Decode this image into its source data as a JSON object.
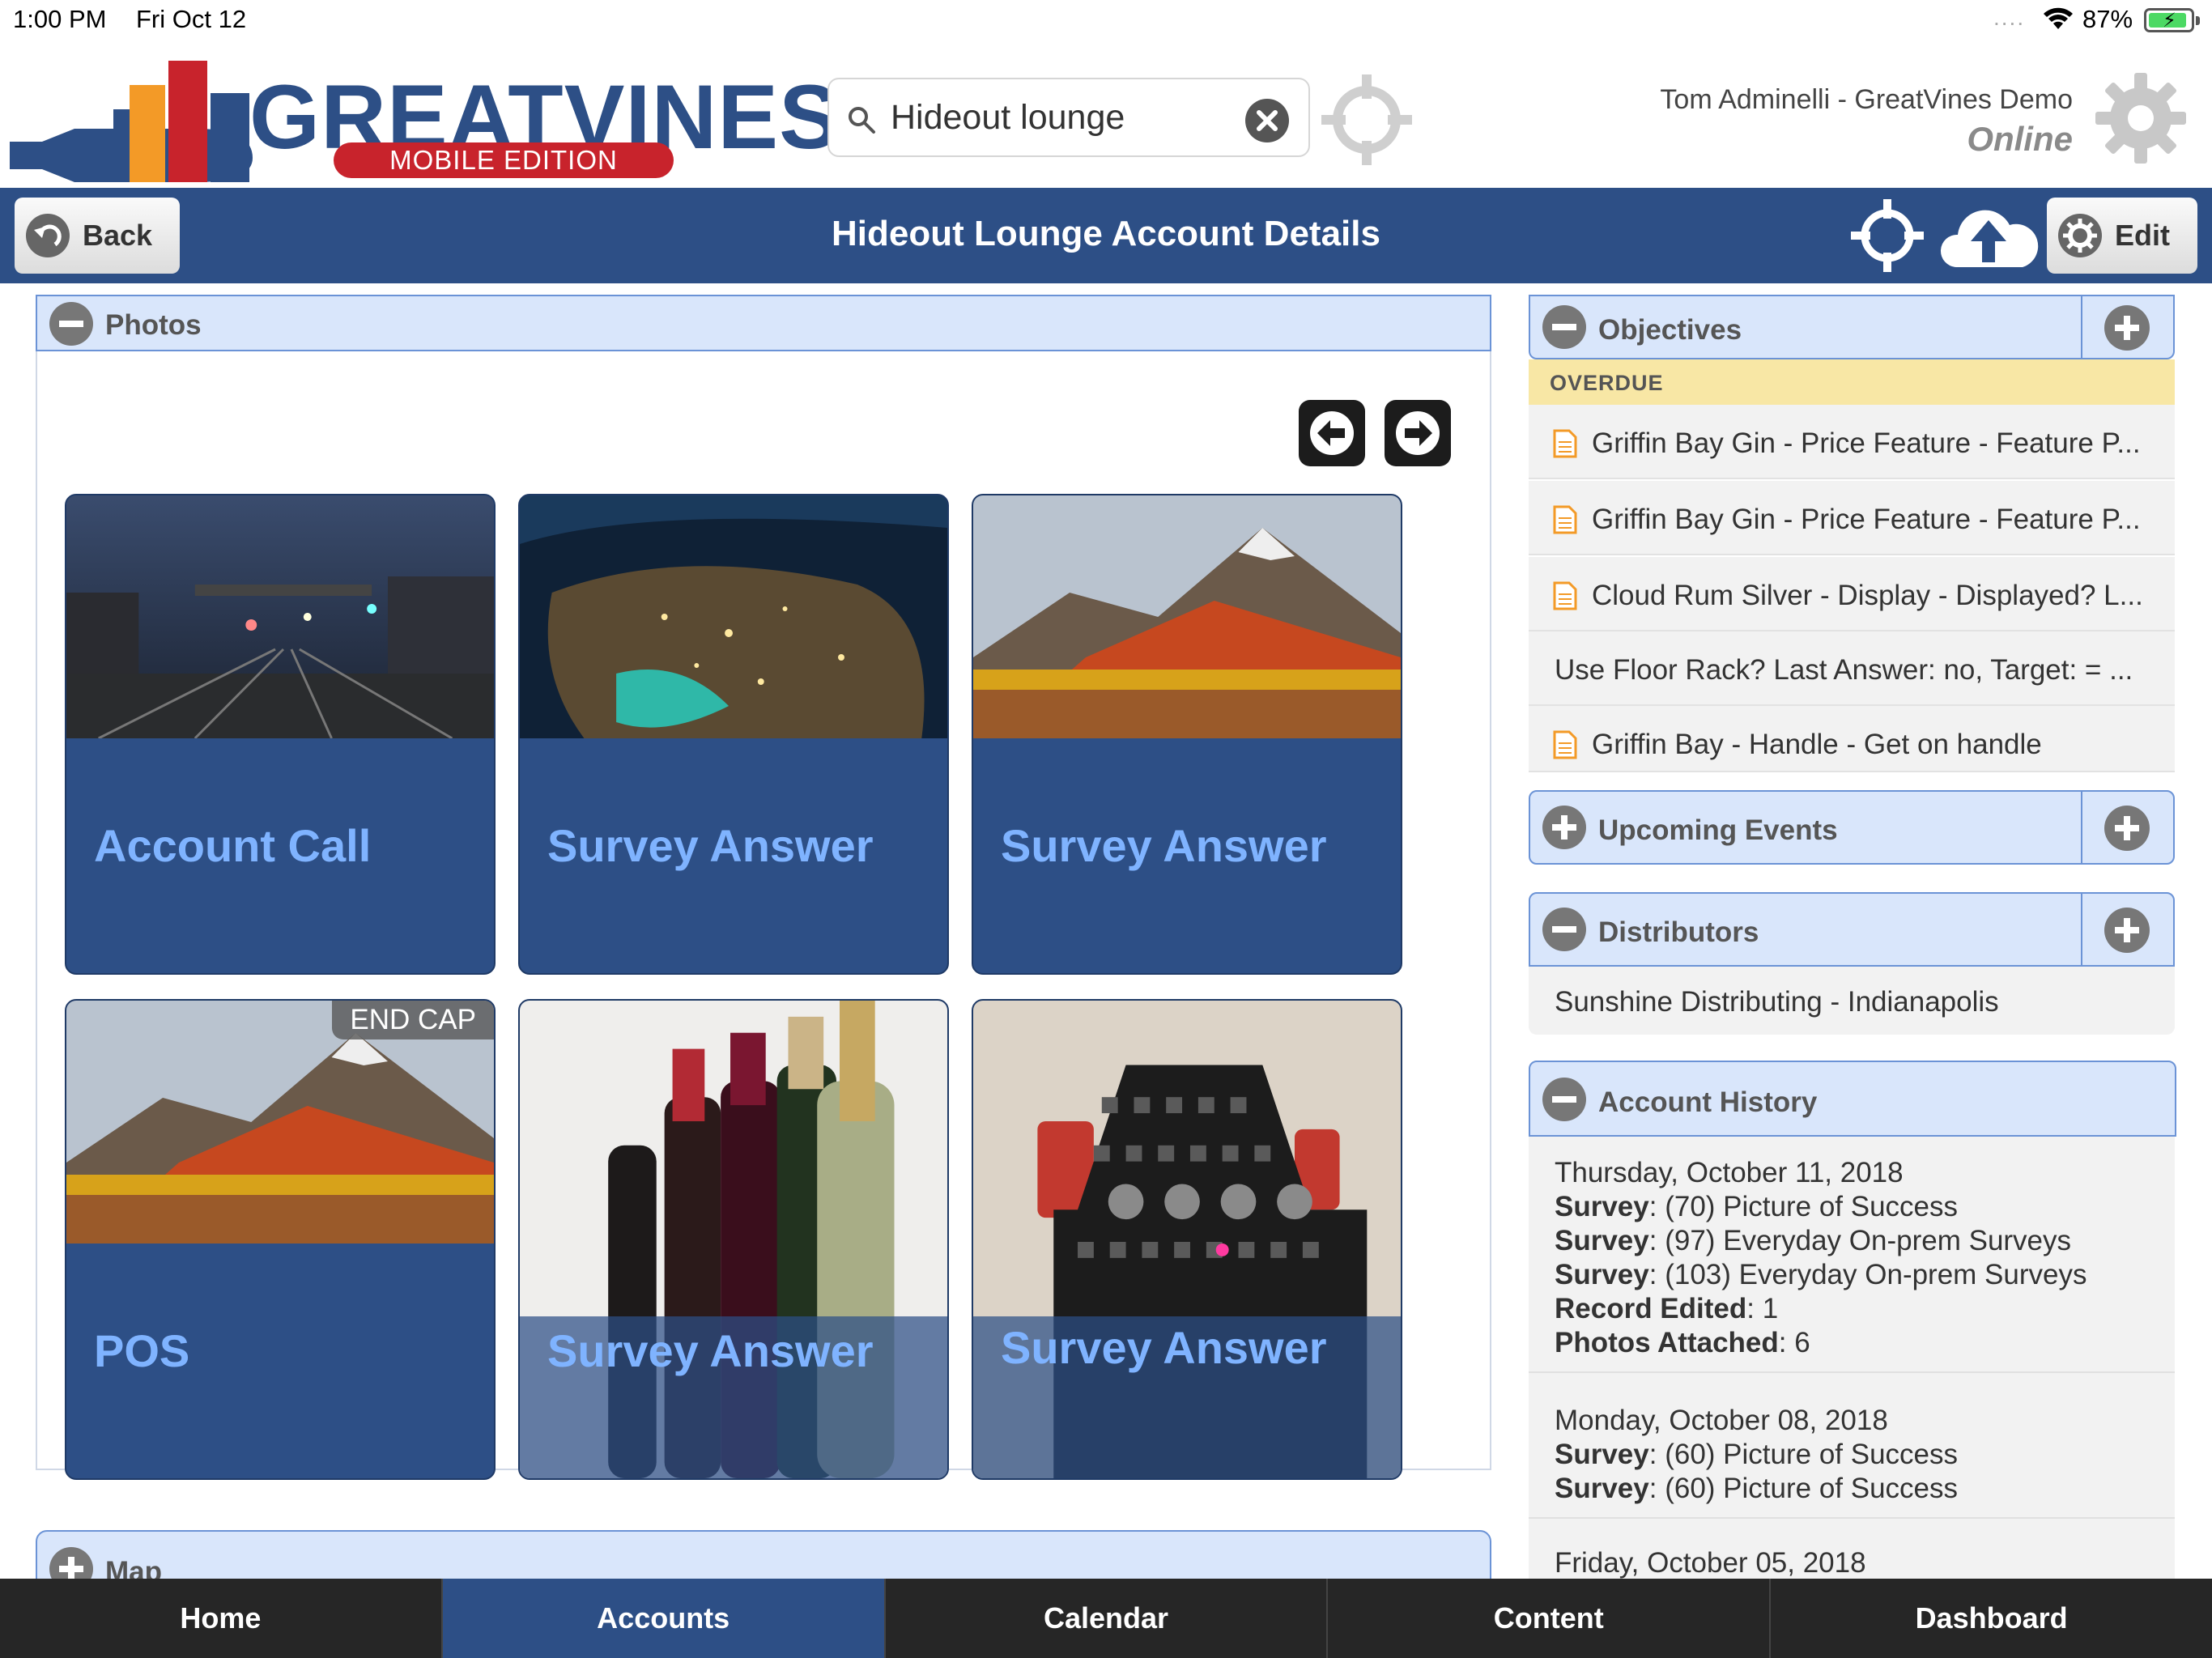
{
  "status_bar": {
    "time": "1:00 PM",
    "date": "Fri Oct 12",
    "signal_dots": "....",
    "battery": "87%"
  },
  "header": {
    "logo_title": "GREATVINES",
    "logo_edition": "MOBILE EDITION",
    "search": {
      "value": "Hideout lounge",
      "placeholder": "Search"
    },
    "user_name": "Tom Adminelli - GreatVines Demo",
    "user_status": "Online"
  },
  "nav": {
    "back_label": "Back",
    "title": "Hideout Lounge Account Details",
    "edit_label": "Edit"
  },
  "photos": {
    "title": "Photos",
    "tiles": [
      {
        "label": "Account Call",
        "badge": ""
      },
      {
        "label": "Survey Answer",
        "badge": ""
      },
      {
        "label": "Survey Answer",
        "badge": ""
      },
      {
        "label": "POS",
        "badge": "END CAP"
      },
      {
        "label": "Survey Answer",
        "badge": ""
      },
      {
        "label": "Survey Answer",
        "badge": ""
      }
    ]
  },
  "map": {
    "title": "Map"
  },
  "objectives": {
    "title": "Objectives",
    "overdue_label": "OVERDUE",
    "items": [
      "Griffin Bay Gin - Price Feature - Feature P...",
      "Griffin Bay Gin - Price Feature - Feature P...",
      "Cloud Rum Silver - Display - Displayed? L...",
      "Use Floor Rack? Last Answer: no, Target: = ...",
      "Griffin Bay - Handle - Get on handle"
    ]
  },
  "upcoming_events": {
    "title": "Upcoming Events"
  },
  "distributors": {
    "title": "Distributors",
    "items": [
      "Sunshine Distributing - Indianapolis"
    ]
  },
  "account_history": {
    "title": "Account History",
    "groups": [
      {
        "date": "Thursday, October 11, 2018",
        "entries": [
          {
            "key": "Survey",
            "value": ": (70) Picture of Success"
          },
          {
            "key": "Survey",
            "value": ": (97) Everyday On-prem Surveys"
          },
          {
            "key": "Survey",
            "value": ": (103) Everyday On-prem Surveys"
          },
          {
            "key": "Record Edited",
            "value": ": 1"
          },
          {
            "key": "Photos Attached",
            "value": ": 6"
          }
        ]
      },
      {
        "date": "Monday, October 08, 2018",
        "entries": [
          {
            "key": "Survey",
            "value": ": (60) Picture of Success"
          },
          {
            "key": "Survey",
            "value": ": (60) Picture of Success"
          }
        ]
      },
      {
        "date": "Friday, October 05, 2018",
        "entries": []
      }
    ]
  },
  "tabs": [
    "Home",
    "Accounts",
    "Calendar",
    "Content",
    "Dashboard"
  ],
  "colors": {
    "brand_blue": "#2d4f86",
    "tile_label": "#7fb3ff",
    "panel_header": "#d9e6fb",
    "overdue": "#f8e7a5",
    "logo_red": "#c8232c",
    "logo_orange": "#f39a27"
  }
}
